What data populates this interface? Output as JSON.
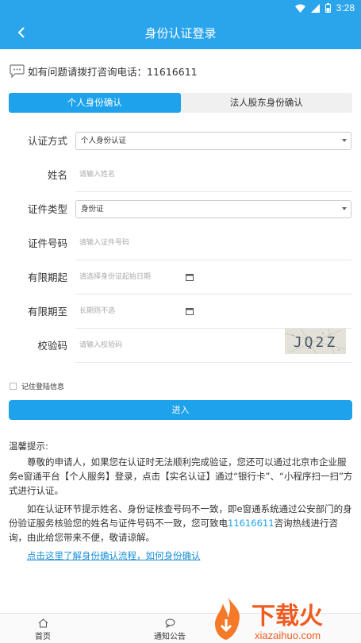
{
  "status": {
    "time": "3:28"
  },
  "header": {
    "title": "身份认证登录"
  },
  "hotline": {
    "text": "如有问题请拨打咨询电话：11616611"
  },
  "tabs": [
    {
      "label": "个人身份确认",
      "active": true
    },
    {
      "label": "法人股东身份确认",
      "active": false
    }
  ],
  "form": {
    "auth_method": {
      "label": "认证方式",
      "value": "个人身份认证"
    },
    "name": {
      "label": "姓名",
      "placeholder": "请输入姓名"
    },
    "id_type": {
      "label": "证件类型",
      "value": "身份证"
    },
    "id_number": {
      "label": "证件号码",
      "placeholder": "请输入证件号码"
    },
    "valid_from": {
      "label": "有限期起",
      "placeholder": "请选择身份证起始日期"
    },
    "valid_to": {
      "label": "有限期至",
      "placeholder": "长期则不选"
    },
    "captcha": {
      "label": "校验码",
      "placeholder": "请输入校验码",
      "image_text": "JQ2Z"
    },
    "remember_label": "记住登陆信息",
    "submit_label": "进入"
  },
  "tips": {
    "heading": "温馨提示:",
    "p1": "尊敬的申请人，如果您在认证时无法顺利完成验证，您还可以通过北京市企业服务e窗通平台【个人服务】登录，点击【实名认证】通过“银行卡”、“小程序扫一扫”方式进行认证。",
    "p2_a": "如在认证环节提示姓名、身份证核查号码不一致，即e窗通系统通过公安部门的身份验证服务核验您的姓名与证件号码不一致，您可致电",
    "p2_phone": "11616611",
    "p2_b": "咨询热线进行咨询，由此给您带来不便，敬请谅解。",
    "link": "点击这里了解身份确认流程，如何身份确认"
  },
  "bottom_nav": [
    {
      "label": "首页",
      "icon": "home-icon"
    },
    {
      "label": "通知公告",
      "icon": "message-icon"
    }
  ],
  "watermark": {
    "brand": "下载火",
    "url": "xiazaihuo.com"
  },
  "colors": {
    "primary": "#2aa5ec",
    "button": "#1ea2ec"
  }
}
